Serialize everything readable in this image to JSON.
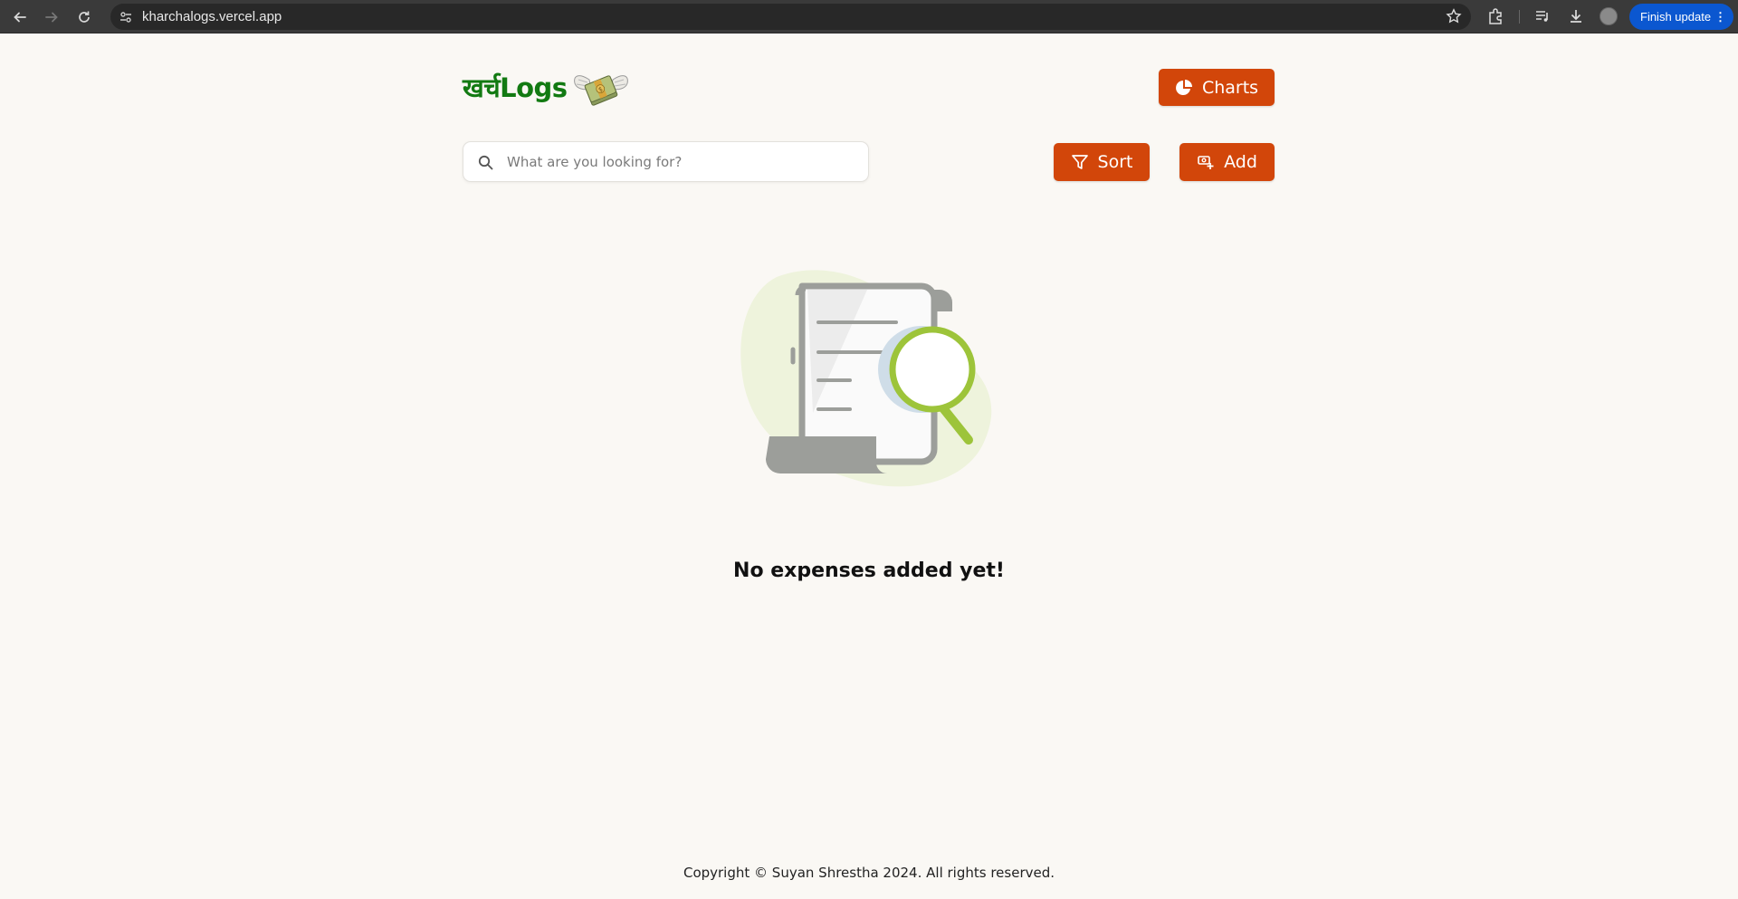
{
  "browser": {
    "url": "kharchalogs.vercel.app",
    "update_label": "Finish update",
    "menu_glyph": "⋮"
  },
  "header": {
    "logo_text": "खर्चLogs",
    "logo_icon": "money-with-wings-icon",
    "charts_label": "Charts"
  },
  "toolbar": {
    "search_placeholder": "What are you looking for?",
    "sort_label": "Sort",
    "add_label": "Add"
  },
  "main": {
    "empty_message": "No expenses added yet!",
    "illustration": "receipt-magnifier-icon"
  },
  "footer": {
    "copyright": "Copyright © Suyan Shrestha 2024. All rights reserved."
  },
  "colors": {
    "accent": "#d2460a",
    "logo_green": "#127a12",
    "background": "#faf8f4"
  }
}
